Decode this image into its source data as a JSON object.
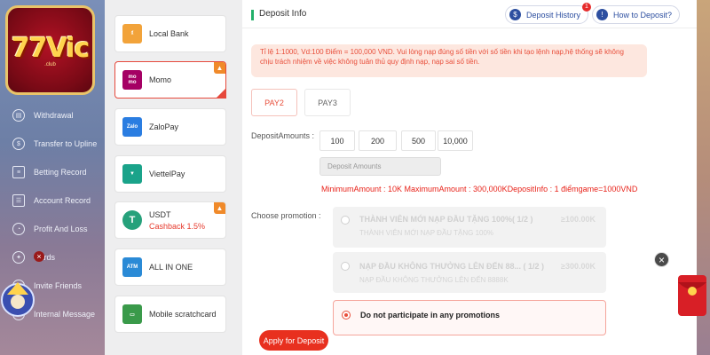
{
  "brand": {
    "logo_text": "77Vic",
    "logo_sub": ".club"
  },
  "sidebar": {
    "items": [
      {
        "label": "Withdrawal",
        "icon": "wallet-icon"
      },
      {
        "label": "Transfer to Upline",
        "icon": "transfer-icon"
      },
      {
        "label": "Betting Record",
        "icon": "record-icon"
      },
      {
        "label": "Account Record",
        "icon": "account-icon"
      },
      {
        "label": "Profit And Loss",
        "icon": "chart-icon"
      },
      {
        "label": "wards",
        "icon": "gift-icon"
      },
      {
        "label": "Invite Friends",
        "icon": "invite-icon"
      },
      {
        "label": "Internal Message",
        "icon": "message-icon"
      }
    ]
  },
  "methods": [
    {
      "label": "Local Bank",
      "icon": "local-bank-icon",
      "color": "#f2a33a",
      "hot": false,
      "active": false
    },
    {
      "label": "Momo",
      "icon": "momo-icon",
      "color": "#a50064",
      "hot": true,
      "active": true
    },
    {
      "label": "ZaloPay",
      "icon": "zalopay-icon",
      "color": "#2a7de1",
      "hot": false,
      "active": false
    },
    {
      "label": "ViettelPay",
      "icon": "viettelpay-icon",
      "color": "#1aa38a",
      "hot": false,
      "active": false
    },
    {
      "label": "USDT",
      "sub": "Cashback 1.5%",
      "icon": "usdt-icon",
      "color": "#26a17b",
      "hot": true,
      "active": false
    },
    {
      "label": "ALL IN ONE",
      "icon": "atm-icon",
      "color": "#2a8ad6",
      "hot": false,
      "active": false
    },
    {
      "label": "Mobile scratchcard",
      "icon": "scratchcard-icon",
      "color": "#3a9a4a",
      "hot": false,
      "active": false
    }
  ],
  "header": {
    "title": "Deposit Info",
    "history_label": "Deposit History",
    "history_badge": "1",
    "how_label": "How to Deposit?"
  },
  "notice": "Tỉ lệ 1:1000, Vd:100 Điểm = 100,000 VND. Vui lòng nạp đúng số tiền với số tiền khi tạo lệnh nạp,hệ thống sẽ không chịu trách nhiệm về việc không tuân thủ quy định nạp, nạp sai số tiền.",
  "channels": [
    "PAY2",
    "PAY3"
  ],
  "deposit": {
    "label": "DepositAmounts :",
    "amounts": [
      "100",
      "200",
      "500",
      "10,000"
    ],
    "placeholder": "Deposit Amounts",
    "limits": "MinimumAmount : 10K  MaximumAmount : 300,000KDepositInfo :  1 điểmgame=1000VND"
  },
  "promotion": {
    "label": "Choose promotion :",
    "options": [
      {
        "title": "THÀNH VIÊN MỚI NẠP ĐẦU TẶNG 100%( 1/2 )",
        "sub": "THÀNH VIÊN MỚI NẠP ĐẦU TẶNG 100%",
        "bonus": "≥100.00K"
      },
      {
        "title": "NẠP ĐẦU KHÔNG THƯỞNG LÊN ĐẾN 88...  ( 1/2 )",
        "sub": "NẠP ĐẦU KHÔNG THƯỞNG LÊN ĐẾN 8888K",
        "bonus": "≥300.00K"
      },
      {
        "title": "Do not participate in any promotions"
      }
    ]
  },
  "apply_label": "Apply for Deposit",
  "close_glyph": "×"
}
